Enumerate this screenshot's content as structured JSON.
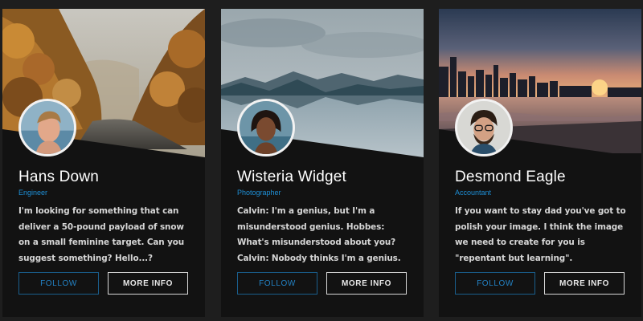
{
  "cards": [
    {
      "name": "Hans Down",
      "role": "Engineer",
      "bio": "I'm looking for something that can deliver a 50-pound payload of snow on a small feminine target. Can you suggest something? Hello...?",
      "follow_label": "FOLLOW",
      "more_label": "MORE INFO",
      "image": "autumn-forest-road"
    },
    {
      "name": "Wisteria Widget",
      "role": "Photographer",
      "bio": "Calvin: I'm a genius, but I'm a misunderstood genius. Hobbes: What's misunderstood about you? Calvin: Nobody thinks I'm a genius.",
      "follow_label": "FOLLOW",
      "more_label": "MORE INFO",
      "image": "mountain-lake"
    },
    {
      "name": "Desmond Eagle",
      "role": "Accountant",
      "bio": "If you want to stay dad you've got to polish your image. I think the image we need to create for you is \"repentant but learning\".",
      "follow_label": "FOLLOW",
      "more_label": "MORE INFO",
      "image": "city-beach-sunset"
    }
  ],
  "colors": {
    "page_bg": "#1e1e1e",
    "card_bg": "#121212",
    "accent": "#1e8fd6",
    "text": "#ffffff",
    "body_text": "#d6d6d6"
  }
}
